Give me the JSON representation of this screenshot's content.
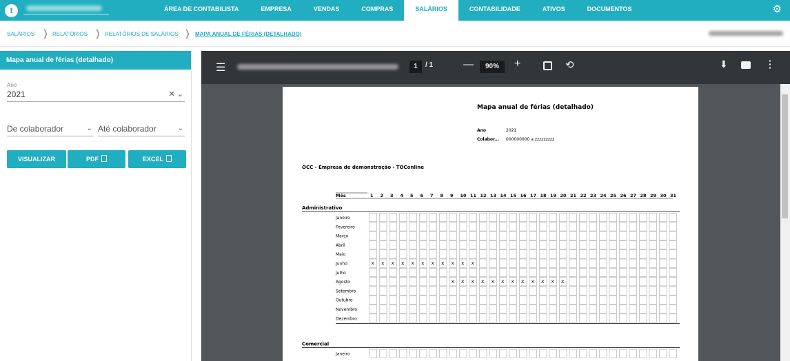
{
  "app": {
    "logo_letter": "t"
  },
  "nav": {
    "tabs": [
      {
        "label": "ÁREA DE CONTABILISTA"
      },
      {
        "label": "EMPRESA"
      },
      {
        "label": "VENDAS"
      },
      {
        "label": "COMPRAS"
      },
      {
        "label": "SALÁRIOS"
      },
      {
        "label": "CONTABILIDADE"
      },
      {
        "label": "ATIVOS"
      },
      {
        "label": "DOCUMENTOS"
      }
    ],
    "active": "SALÁRIOS"
  },
  "breadcrumb": [
    "SALÁRIOS",
    "RELATÓRIOS",
    "RELATÓRIOS DE SALÁRIOS",
    "MAPA ANUAL DE FÉRIAS (DETALHADO)"
  ],
  "sidebar": {
    "title": "Mapa anual de férias (detalhado)",
    "ano_label": "Ano",
    "ano_value": "2021",
    "from_placeholder": "De colaborador",
    "to_placeholder": "Até colaborador",
    "buttons": {
      "view": "VISUALIZAR",
      "pdf": "PDF",
      "excel": "EXCEL"
    }
  },
  "viewer": {
    "page_current": "1",
    "page_total": "/ 1",
    "zoom": "90%"
  },
  "report": {
    "title": "Mapa anual de férias (detalhado)",
    "ano_label": "Ano",
    "ano_value": "2021",
    "colab_label": "Colabor...",
    "colab_value": "000000000 a zzzzzzzzz",
    "company": "OCC - Empresa de demonstração - TOConline",
    "month_header": "Mês",
    "days": [
      "1",
      "2",
      "3",
      "4",
      "5",
      "6",
      "7",
      "8",
      "9",
      "10",
      "11",
      "12",
      "13",
      "14",
      "15",
      "16",
      "17",
      "18",
      "19",
      "20",
      "21",
      "22",
      "23",
      "24",
      "25",
      "26",
      "27",
      "28",
      "29",
      "30",
      "31"
    ],
    "sections": [
      {
        "name": "Administrativo",
        "months": [
          "Janeiro",
          "Fevereiro",
          "Março",
          "Abril",
          "Maio",
          "Junho",
          "Julho",
          "Agosto",
          "Setembro",
          "Outubro",
          "Novembro",
          "Dezembro"
        ],
        "marks": {
          "Junho": [
            1,
            2,
            3,
            4,
            5,
            6,
            7,
            8,
            9,
            10,
            11
          ],
          "Agosto": [
            9,
            10,
            11,
            12,
            13,
            14,
            15,
            16,
            17,
            18,
            19,
            20
          ]
        },
        "mark_symbol": "X"
      },
      {
        "name": "Comercial",
        "months": [
          "Janeiro"
        ],
        "marks": {},
        "mark_symbol": "X"
      }
    ]
  },
  "colors": {
    "accent": "#21aec0",
    "viewer_bg": "#525659",
    "viewer_toolbar": "#323639"
  }
}
